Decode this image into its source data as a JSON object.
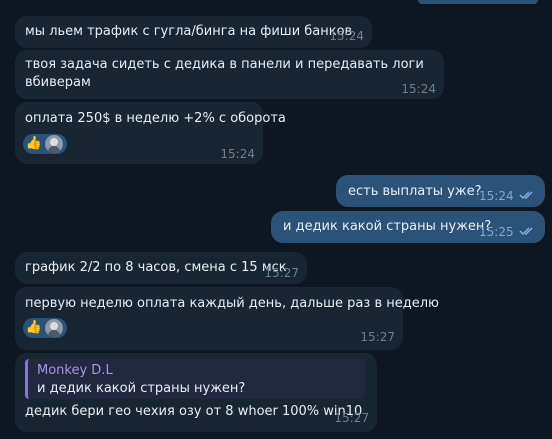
{
  "messages": [
    {
      "text": "мы льем трафик с гугла/бинга на фиши банков",
      "time": "15:24"
    },
    {
      "text_line1": "твоя задача сидеть с дедика в панели и передавать логи",
      "text_line2": "вбиверам",
      "time": "15:24"
    },
    {
      "text": "оплата 250$ в неделю +2% с оборота",
      "time": "15:24",
      "reaction": "👍"
    },
    {
      "text": "есть выплаты уже?",
      "time": "15:24"
    },
    {
      "text": "и дедик какой страны нужен?",
      "time": "15:25"
    },
    {
      "text": "график 2/2 по 8 часов, смена с 15 мск",
      "time": "15:27"
    },
    {
      "text": "первую неделю оплата каждый день, дальше раз в неделю",
      "time": "15:27",
      "reaction": "👍"
    },
    {
      "reply_name": "Monkey D.L",
      "reply_text": "и дедик какой страны нужен?",
      "text": "дедик бери гео чехия озу от 8 whoer 100% win10",
      "time": "15:27"
    }
  ],
  "colors": {
    "background": "#0e1621",
    "incoming_bubble": "#182533",
    "outgoing_bubble": "#2b5278",
    "reply_accent": "#8d74d6"
  }
}
